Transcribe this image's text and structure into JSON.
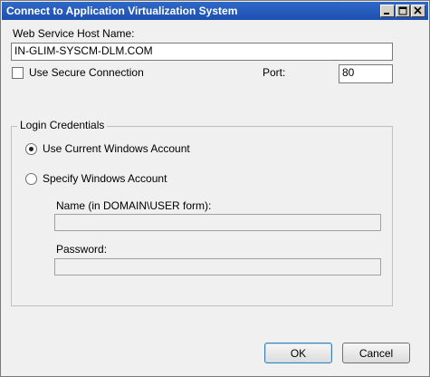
{
  "window": {
    "title": "Connect to Application Virtualization System"
  },
  "connection": {
    "host_label": "Web Service Host Name:",
    "host_value": "IN-GLIM-SYSCM-DLM.COM",
    "secure_label": "Use Secure Connection",
    "secure_checked": false,
    "port_label": "Port:",
    "port_value": "80"
  },
  "credentials": {
    "group_title": "Login Credentials",
    "use_current_label": "Use Current Windows Account",
    "use_current_selected": true,
    "specify_label": "Specify Windows Account",
    "specify_selected": false,
    "name_label": "Name (in DOMAIN\\USER form):",
    "name_value": "",
    "password_label": "Password:",
    "password_value": ""
  },
  "buttons": {
    "ok_label": "OK",
    "cancel_label": "Cancel"
  }
}
